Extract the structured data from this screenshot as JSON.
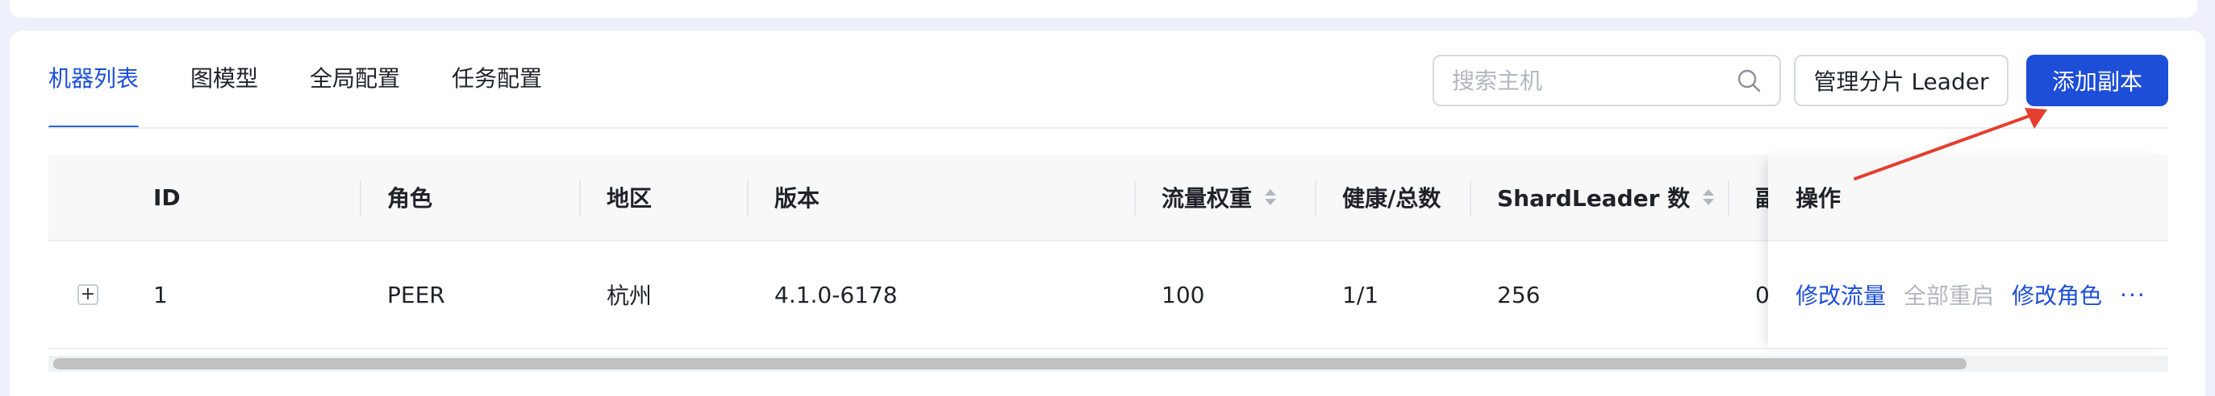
{
  "tabs": [
    {
      "label": "机器列表",
      "active": true
    },
    {
      "label": "图模型",
      "active": false
    },
    {
      "label": "全局配置",
      "active": false
    },
    {
      "label": "任务配置",
      "active": false
    }
  ],
  "toolbar": {
    "search_placeholder": "搜索主机",
    "search_value": "",
    "manage_leader_label": "管理分片 Leader",
    "add_replica_label": "添加副本"
  },
  "table": {
    "columns": {
      "id": "ID",
      "role": "角色",
      "region": "地区",
      "version": "版本",
      "traffic_weight": "流量权重",
      "healthy_total": "健康/总数",
      "shard_leader": "ShardLeader 数",
      "replica_partial": "副",
      "actions": "操作"
    },
    "rows": [
      {
        "expand": "+",
        "id": "1",
        "role": "PEER",
        "region": "杭州",
        "version": "4.1.0-6178",
        "traffic_weight": "100",
        "healthy_total": "1/1",
        "shard_leader": "256",
        "replica_partial": "0",
        "actions": {
          "modify_traffic": "修改流量",
          "restart_all": "全部重启",
          "modify_role": "修改角色",
          "more": "···"
        }
      }
    ]
  },
  "colors": {
    "accent": "#1d4ed8",
    "annotation_arrow": "#e53e2e",
    "disabled_text": "#b3b7bf",
    "page_bg": "#eef0fb"
  },
  "icons": [
    "search-icon",
    "sort-icon",
    "expand-icon",
    "more-icon"
  ]
}
